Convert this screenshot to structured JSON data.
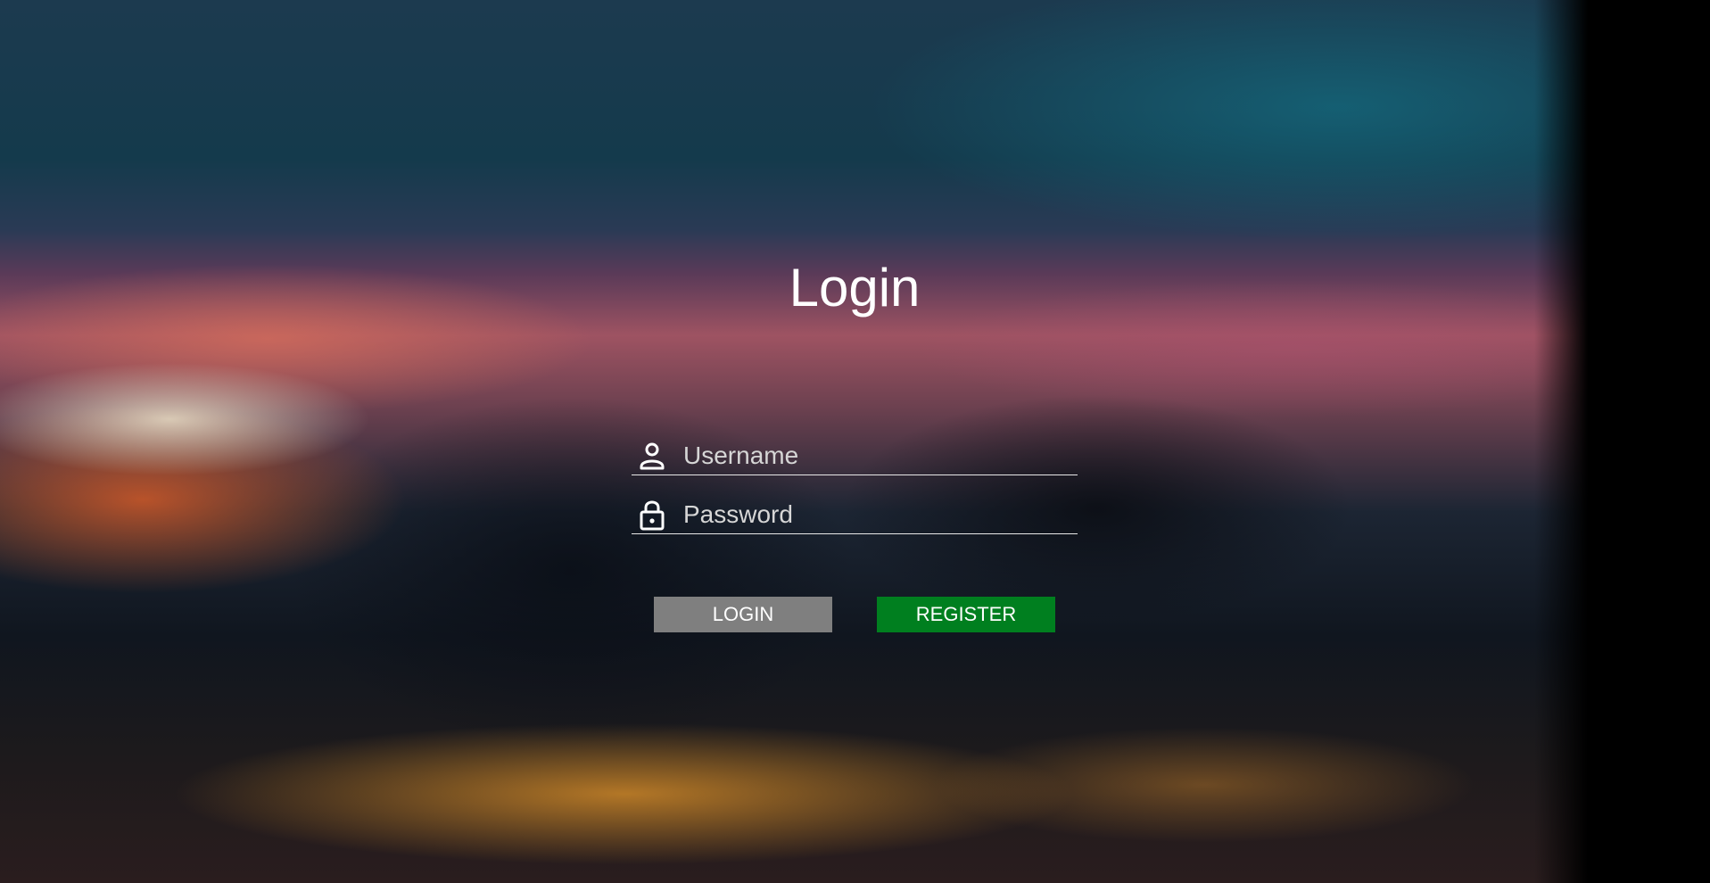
{
  "page": {
    "title": "Login"
  },
  "form": {
    "username": {
      "placeholder": "Username",
      "value": "",
      "icon": "user-icon"
    },
    "password": {
      "placeholder": "Password",
      "value": "",
      "icon": "lock-icon"
    },
    "buttons": {
      "login_label": "LOGIN",
      "register_label": "REGISTER"
    }
  },
  "colors": {
    "login_button": "#7f7f7f",
    "register_button": "#007f1f",
    "text": "#ffffff",
    "underline": "#e8e8e8"
  }
}
